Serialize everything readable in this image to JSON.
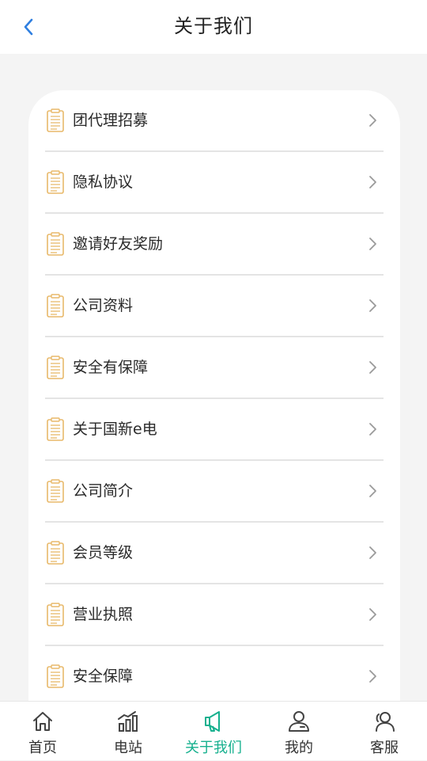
{
  "header": {
    "title": "关于我们"
  },
  "menu": {
    "items": [
      {
        "label": "团代理招募"
      },
      {
        "label": "隐私协议"
      },
      {
        "label": "邀请好友奖励"
      },
      {
        "label": "公司资料"
      },
      {
        "label": "安全有保障"
      },
      {
        "label": "关于国新e电"
      },
      {
        "label": "公司简介"
      },
      {
        "label": "会员等级"
      },
      {
        "label": "营业执照"
      },
      {
        "label": "安全保障"
      }
    ]
  },
  "tabbar": {
    "tabs": [
      {
        "label": "首页",
        "icon": "home-icon"
      },
      {
        "label": "电站",
        "icon": "station-chart-icon"
      },
      {
        "label": "关于我们",
        "icon": "megaphone-icon",
        "active": true
      },
      {
        "label": "我的",
        "icon": "user-icon"
      },
      {
        "label": "客服",
        "icon": "service-icon"
      }
    ]
  },
  "colors": {
    "accent": "#16b08e",
    "back_arrow": "#2f7fe0",
    "doc_icon": "#e8b96a",
    "background": "#f4f4f4"
  }
}
